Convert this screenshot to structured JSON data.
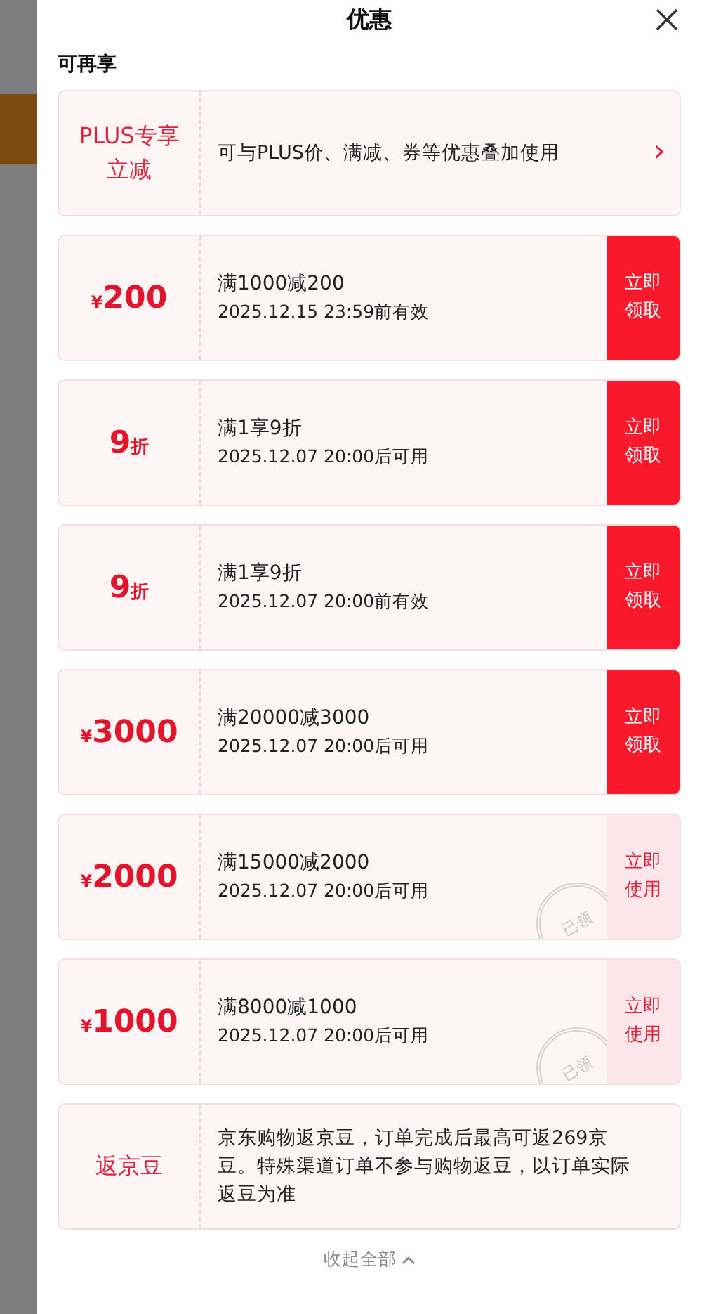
{
  "sheet": {
    "title": "优惠",
    "section_title": "可再享",
    "coupons": [
      {
        "kind": "plus",
        "label": "PLUS专享立减",
        "description": "可与PLUS价、满减、券等优惠叠加使用",
        "chevron": "›"
      },
      {
        "kind": "amount",
        "prefix": "¥",
        "value": "200",
        "condition": "满1000减200",
        "validity": "2025.12.15 23:59前有效",
        "action": "立即领取",
        "claimed": false
      },
      {
        "kind": "discount",
        "value": "9",
        "suffix": "折",
        "condition": "满1享9折",
        "validity": "2025.12.07 20:00后可用",
        "action": "立即领取",
        "claimed": false
      },
      {
        "kind": "discount",
        "value": "9",
        "suffix": "折",
        "condition": "满1享9折",
        "validity": "2025.12.07 20:00前有效",
        "action": "立即领取",
        "claimed": false
      },
      {
        "kind": "amount",
        "prefix": "¥",
        "value": "3000",
        "condition": "满20000减3000",
        "validity": "2025.12.07 20:00后可用",
        "action": "立即领取",
        "claimed": false
      },
      {
        "kind": "amount",
        "prefix": "¥",
        "value": "2000",
        "condition": "满15000减2000",
        "validity": "2025.12.07 20:00后可用",
        "action": "立即使用",
        "claimed": true,
        "stamp": "已领"
      },
      {
        "kind": "amount",
        "prefix": "¥",
        "value": "1000",
        "condition": "满8000减1000",
        "validity": "2025.12.07 20:00后可用",
        "action": "立即使用",
        "claimed": true,
        "stamp": "已领"
      },
      {
        "kind": "beans",
        "label": "返京豆",
        "description": "京东购物返京豆，订单完成后最高可返269京豆。特殊渠道订单不参与购物返豆，以订单实际返豆为准"
      }
    ],
    "collapse_link": "收起全部"
  }
}
